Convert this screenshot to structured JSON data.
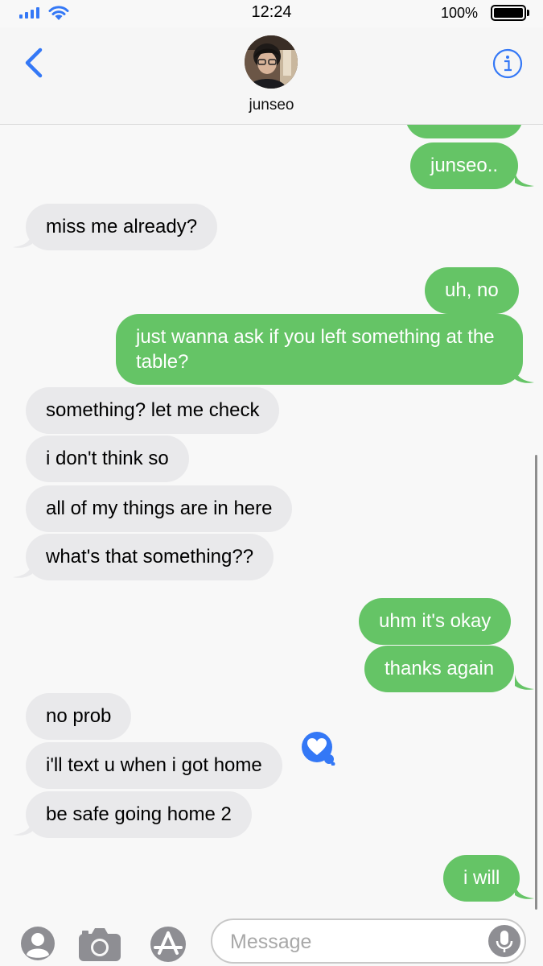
{
  "status": {
    "time": "12:24",
    "battery_pct": "100%",
    "battery_level": 1.0,
    "signal_bars": 4
  },
  "header": {
    "contact_name": "junseo",
    "back_icon": "chevron-left-icon",
    "info_icon": "info-icon",
    "accent_color": "#3478f6"
  },
  "colors": {
    "outgoing_bubble": "#65c466",
    "incoming_bubble": "#e9e9eb"
  },
  "messages": [
    {
      "dir": "out",
      "text": "junseo.."
    },
    {
      "dir": "in",
      "text": "miss me already?"
    },
    {
      "dir": "out",
      "text": "uh, no"
    },
    {
      "dir": "out",
      "text": "just wanna ask if you left something at the table?"
    },
    {
      "dir": "in",
      "text": "something? let me check"
    },
    {
      "dir": "in",
      "text": "i don't think so"
    },
    {
      "dir": "in",
      "text": "all of my things are in here"
    },
    {
      "dir": "in",
      "text": "what's that something??"
    },
    {
      "dir": "out",
      "text": "uhm it's okay"
    },
    {
      "dir": "out",
      "text": "thanks again"
    },
    {
      "dir": "in",
      "text": "no prob"
    },
    {
      "dir": "in",
      "text": "i'll text u when i got home",
      "reaction": "heart"
    },
    {
      "dir": "in",
      "text": "be safe going home 2"
    },
    {
      "dir": "out",
      "text": "i will"
    }
  ],
  "compose": {
    "placeholder": "Message",
    "icons": [
      "person-icon",
      "camera-icon",
      "app-store-icon",
      "microphone-icon"
    ]
  }
}
